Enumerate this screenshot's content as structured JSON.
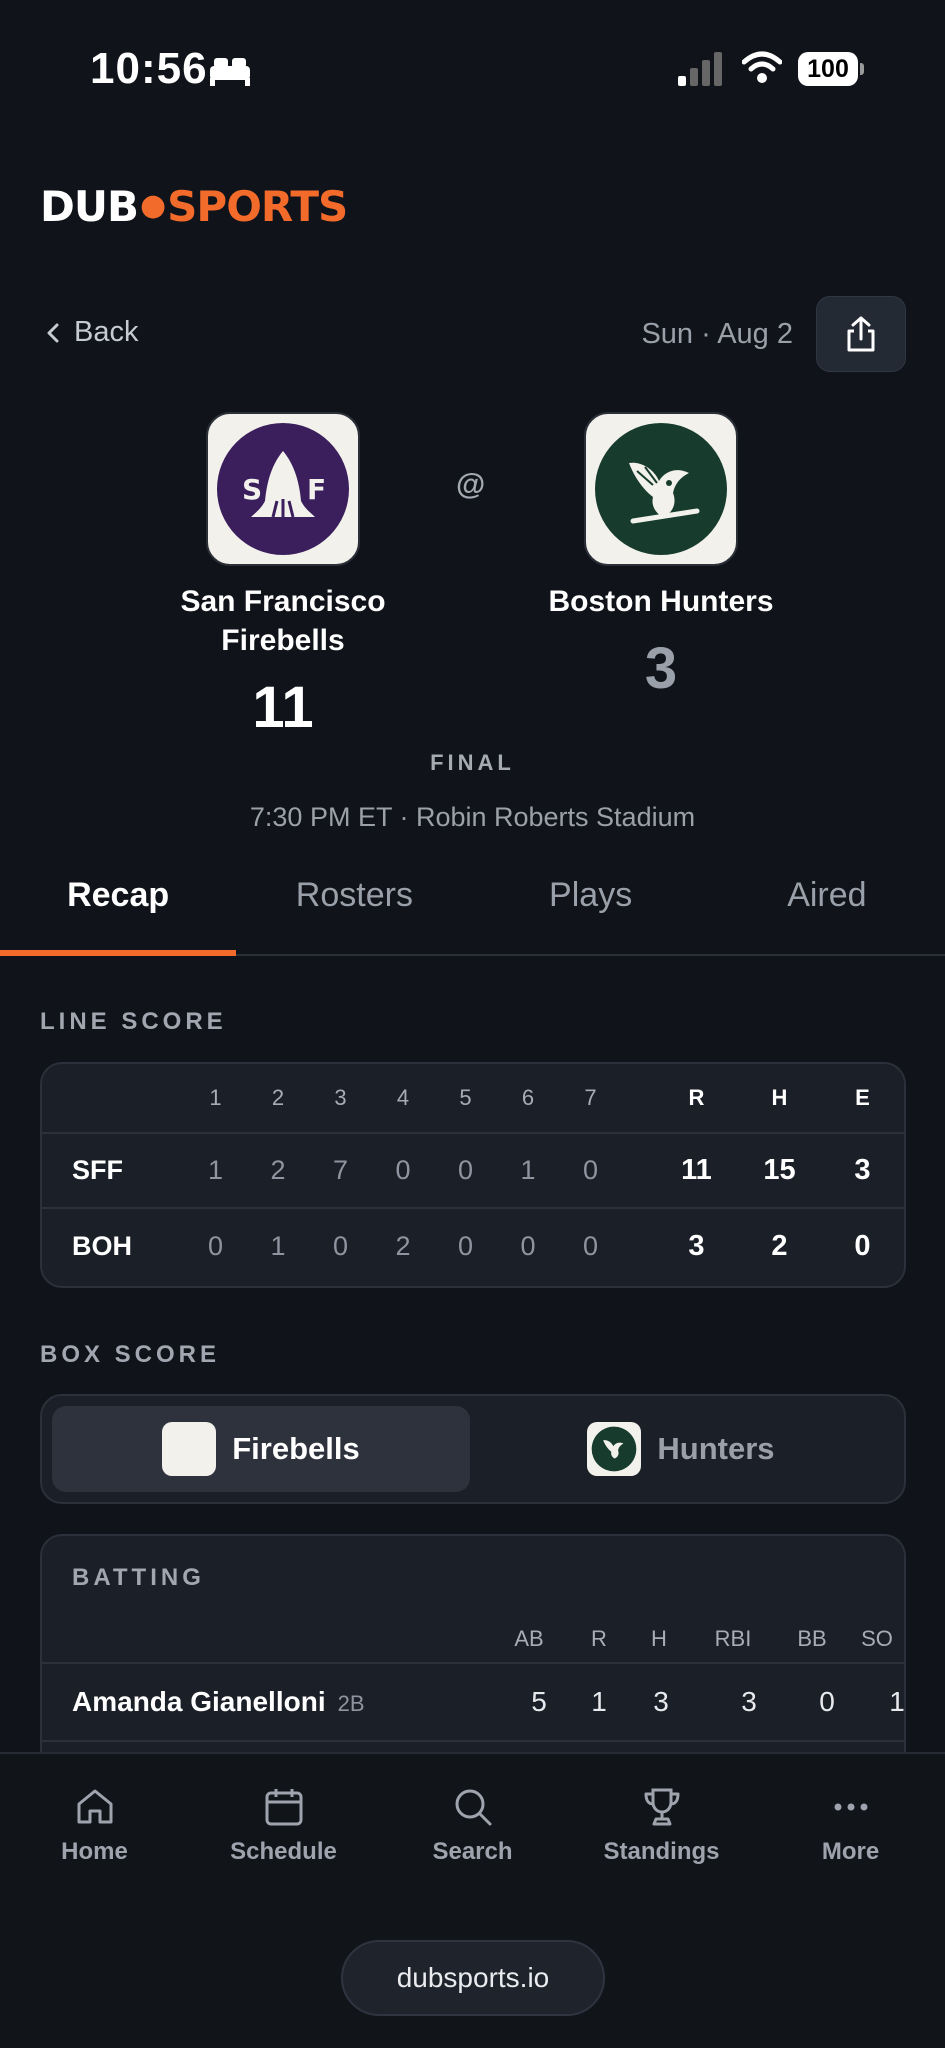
{
  "status_bar": {
    "time": "10:56",
    "battery": "100"
  },
  "brand": {
    "part1": "DUB",
    "part2": "SPORTS",
    "accent": "#f36b2b"
  },
  "header": {
    "back_label": "Back",
    "date": "Sun · Aug 2"
  },
  "game": {
    "away": {
      "name": "San Francisco Firebells",
      "score": "11",
      "logo_letters": [
        "S",
        "F"
      ],
      "color": "#3a1f5c"
    },
    "home": {
      "name": "Boston Hunters",
      "score": "3",
      "color": "#173c2e"
    },
    "separator": "@",
    "status": "FINAL",
    "venue": "7:30 PM ET · Robin Roberts Stadium"
  },
  "tabs": [
    "Recap",
    "Rosters",
    "Plays",
    "Aired"
  ],
  "line_score": {
    "label": "LINE SCORE",
    "innings": [
      "1",
      "2",
      "3",
      "4",
      "5",
      "6",
      "7"
    ],
    "totals_headers": [
      "R",
      "H",
      "E"
    ],
    "rows": [
      {
        "team": "SFF",
        "innings": [
          "1",
          "2",
          "7",
          "0",
          "0",
          "1",
          "0"
        ],
        "totals": [
          "11",
          "15",
          "3"
        ]
      },
      {
        "team": "BOH",
        "innings": [
          "0",
          "1",
          "0",
          "2",
          "0",
          "0",
          "0"
        ],
        "totals": [
          "3",
          "2",
          "0"
        ]
      }
    ]
  },
  "box_score": {
    "label": "BOX SCORE",
    "team_toggle": [
      "Firebells",
      "Hunters"
    ],
    "batting": {
      "title": "BATTING",
      "columns": [
        "AB",
        "R",
        "H",
        "RBI",
        "BB",
        "SO"
      ],
      "rows": [
        {
          "name": "Amanda Gianelloni",
          "pos": "2B",
          "stats": [
            "5",
            "1",
            "3",
            "3",
            "0",
            "1"
          ]
        }
      ]
    }
  },
  "bottom_nav": [
    {
      "label": "Home",
      "icon": "home-icon"
    },
    {
      "label": "Schedule",
      "icon": "calendar-icon"
    },
    {
      "label": "Search",
      "icon": "search-icon"
    },
    {
      "label": "Standings",
      "icon": "trophy-icon"
    },
    {
      "label": "More",
      "icon": "more-icon"
    }
  ],
  "url": "dubsports.io"
}
